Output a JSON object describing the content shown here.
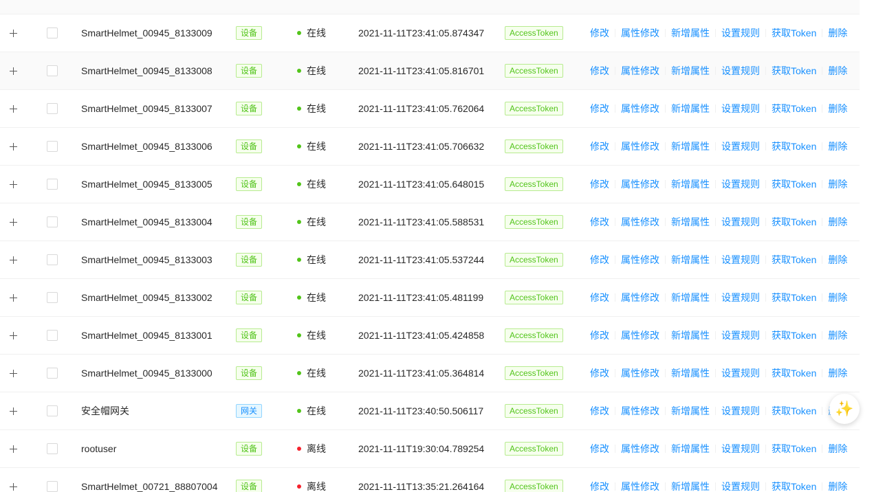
{
  "actions": [
    "修改",
    "属性修改",
    "新增属性",
    "设置规则",
    "获取Token",
    "删除"
  ],
  "colors": {
    "online": "#52c41a",
    "offline": "#f5222d",
    "link": "#1890ff"
  },
  "float_button": {
    "icon": "magic-wand-icon",
    "glyph": "✨"
  },
  "rows": [
    {
      "name": "SmartHelmet_00945_8133009",
      "type": "设备",
      "type_style": "green",
      "status": "在线",
      "status_kind": "online",
      "time": "2021-11-11T23:41:05.874347",
      "token": "AccessToken"
    },
    {
      "name": "SmartHelmet_00945_8133008",
      "type": "设备",
      "type_style": "green",
      "status": "在线",
      "status_kind": "online",
      "time": "2021-11-11T23:41:05.816701",
      "token": "AccessToken"
    },
    {
      "name": "SmartHelmet_00945_8133007",
      "type": "设备",
      "type_style": "green",
      "status": "在线",
      "status_kind": "online",
      "time": "2021-11-11T23:41:05.762064",
      "token": "AccessToken"
    },
    {
      "name": "SmartHelmet_00945_8133006",
      "type": "设备",
      "type_style": "green",
      "status": "在线",
      "status_kind": "online",
      "time": "2021-11-11T23:41:05.706632",
      "token": "AccessToken"
    },
    {
      "name": "SmartHelmet_00945_8133005",
      "type": "设备",
      "type_style": "green",
      "status": "在线",
      "status_kind": "online",
      "time": "2021-11-11T23:41:05.648015",
      "token": "AccessToken"
    },
    {
      "name": "SmartHelmet_00945_8133004",
      "type": "设备",
      "type_style": "green",
      "status": "在线",
      "status_kind": "online",
      "time": "2021-11-11T23:41:05.588531",
      "token": "AccessToken"
    },
    {
      "name": "SmartHelmet_00945_8133003",
      "type": "设备",
      "type_style": "green",
      "status": "在线",
      "status_kind": "online",
      "time": "2021-11-11T23:41:05.537244",
      "token": "AccessToken"
    },
    {
      "name": "SmartHelmet_00945_8133002",
      "type": "设备",
      "type_style": "green",
      "status": "在线",
      "status_kind": "online",
      "time": "2021-11-11T23:41:05.481199",
      "token": "AccessToken"
    },
    {
      "name": "SmartHelmet_00945_8133001",
      "type": "设备",
      "type_style": "green",
      "status": "在线",
      "status_kind": "online",
      "time": "2021-11-11T23:41:05.424858",
      "token": "AccessToken"
    },
    {
      "name": "SmartHelmet_00945_8133000",
      "type": "设备",
      "type_style": "green",
      "status": "在线",
      "status_kind": "online",
      "time": "2021-11-11T23:41:05.364814",
      "token": "AccessToken"
    },
    {
      "name": "安全帽网关",
      "type": "网关",
      "type_style": "blue",
      "status": "在线",
      "status_kind": "online",
      "time": "2021-11-11T23:40:50.506117",
      "token": "AccessToken"
    },
    {
      "name": "rootuser",
      "type": "设备",
      "type_style": "green",
      "status": "离线",
      "status_kind": "offline",
      "time": "2021-11-11T19:30:04.789254",
      "token": "AccessToken"
    },
    {
      "name": "SmartHelmet_00721_88807004",
      "type": "设备",
      "type_style": "green",
      "status": "离线",
      "status_kind": "offline",
      "time": "2021-11-11T13:35:21.264164",
      "token": "AccessToken"
    }
  ]
}
